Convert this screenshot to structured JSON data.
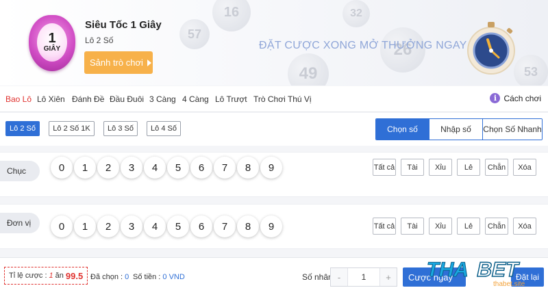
{
  "header": {
    "logo": {
      "number": "1",
      "unit": "GIÂY"
    },
    "game_title": "Siêu Tốc 1 Giây",
    "game_subtitle": "Lô 2 Số",
    "lobby_button": "Sảnh trò chơi",
    "slogan": "ĐẶT CƯỢC XONG MỞ THƯỞNG NGAY",
    "bg_balls": [
      "26",
      "49",
      "53",
      "32",
      "57",
      "16"
    ]
  },
  "tabs": {
    "items": [
      "Bao Lô",
      "Lô Xiên",
      "Đánh Đề",
      "Đầu Đuôi",
      "3 Càng",
      "4 Càng",
      "Lô Trượt",
      "Trò Chơi Thú Vị"
    ],
    "active": "Bao Lô",
    "help_label": "Cách chơi"
  },
  "subtabs": {
    "items": [
      "Lô 2 Số",
      "Lô 2 Số 1K",
      "Lô 3 Số",
      "Lô 4 Số"
    ],
    "active": "Lô 2 Số"
  },
  "modes": {
    "items": [
      "Chọn số",
      "Nhập số",
      "Chọn Số Nhanh"
    ],
    "active": "Chọn số"
  },
  "rows": [
    {
      "label": "Chục",
      "digits": [
        "0",
        "1",
        "2",
        "3",
        "4",
        "5",
        "6",
        "7",
        "8",
        "9"
      ]
    },
    {
      "label": "Đơn vị",
      "digits": [
        "0",
        "1",
        "2",
        "3",
        "4",
        "5",
        "6",
        "7",
        "8",
        "9"
      ]
    }
  ],
  "quick_buttons": [
    "Tất cả",
    "Tài",
    "Xỉu",
    "Lẻ",
    "Chẵn",
    "Xóa"
  ],
  "footer": {
    "odds_label": "Tỉ lệ cược :",
    "odds_prefix": "1",
    "odds_mid": "ăn",
    "odds_value": "99.5",
    "selected_label": "Đã chọn :",
    "selected_value": "0",
    "amount_label": "Số tiền :",
    "amount_value": "0 VND",
    "multiplier_label": "Số nhân :",
    "multiplier_minus": "-",
    "multiplier_value": "1",
    "multiplier_plus": "+",
    "bet_button": "Cược ngay",
    "reset_button": "Đặt lại"
  },
  "watermark": {
    "brand_a": "THA",
    "brand_b": "BET",
    "sub": "thabet.site"
  },
  "colors": {
    "accent": "#2f6fd6",
    "active_tab": "#e0322f",
    "lobby_button": "#f7b14a",
    "logo": "#d04cc4"
  }
}
